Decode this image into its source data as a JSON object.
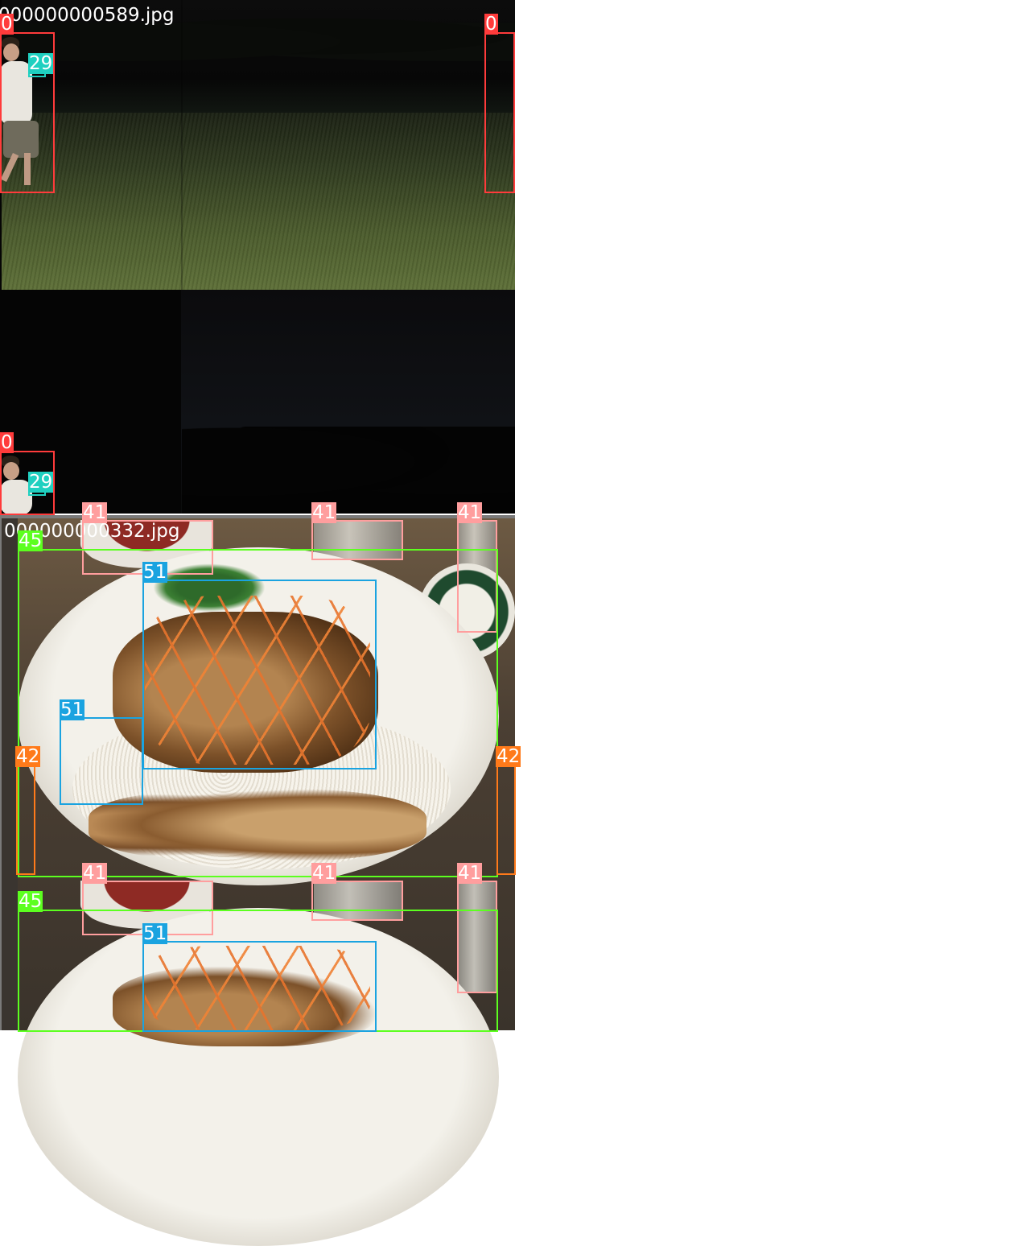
{
  "images": [
    {
      "filename": "000000000589.jpg",
      "content": "night field photo with person"
    },
    {
      "filename": "000000000332.jpg",
      "content": "bowl of rice noodles with spring rolls"
    }
  ],
  "detections": {
    "class_ids": {
      "person": "0",
      "frisbee": "29",
      "cup": "41",
      "fork": "42",
      "bowl": "45",
      "carrot": "51"
    },
    "colors": {
      "0": "#ff3b3b",
      "29": "#1fd0c0",
      "41": "#ff9e9e",
      "42": "#ff7a1a",
      "45": "#5cff1f",
      "51": "#1aa3e0"
    }
  }
}
